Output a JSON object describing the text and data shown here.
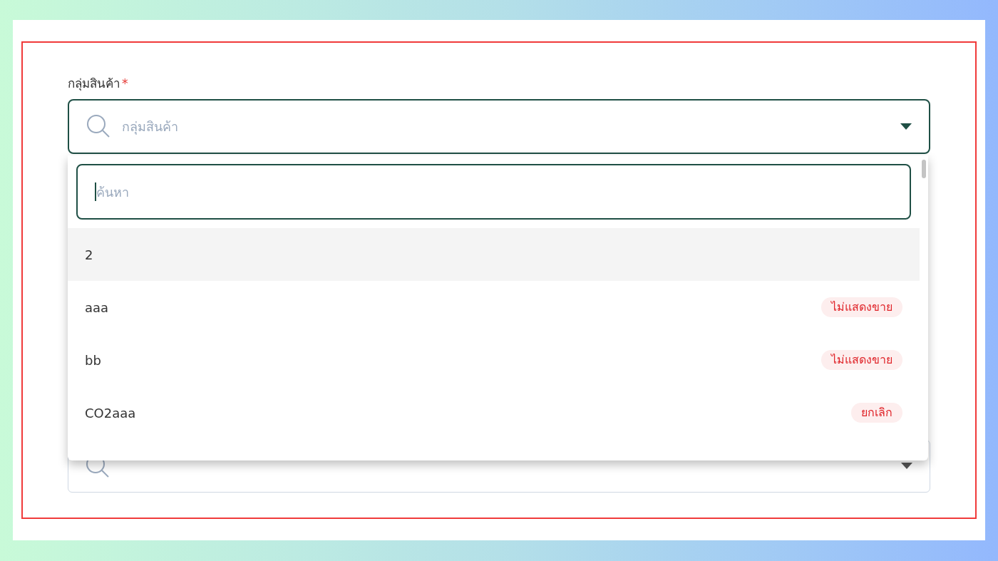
{
  "field": {
    "label": "กลุ่มสินค้า",
    "required_mark": "*",
    "placeholder": "กลุ่มสินค้า",
    "expanded": true
  },
  "dropdown": {
    "search_placeholder": "ค้นหา",
    "options": [
      {
        "label": "2",
        "highlighted": true
      },
      {
        "label": "aaa",
        "highlighted": false,
        "tag": "ไม่แสดงขาย"
      },
      {
        "label": "bb",
        "highlighted": false,
        "tag": "ไม่แสดงขาย"
      },
      {
        "label": "CO2aaa",
        "highlighted": false,
        "tag": "ยกเลิก"
      }
    ]
  }
}
